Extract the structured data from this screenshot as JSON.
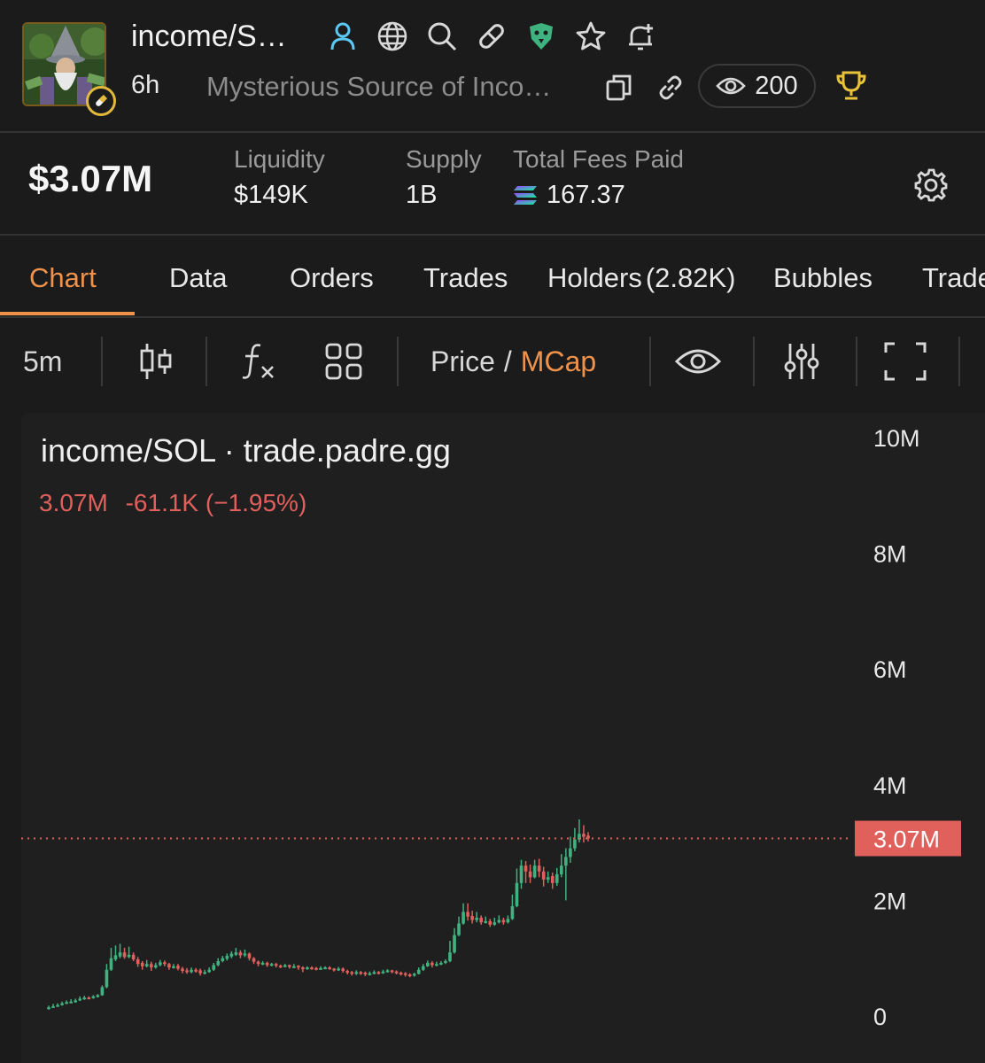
{
  "header": {
    "title": "income/S…",
    "age": "6h",
    "description": "Mysterious Source of Inco…",
    "viewers": "200",
    "icons": [
      "user-icon",
      "globe-icon",
      "search-icon",
      "pill-icon",
      "eagle-icon",
      "star-icon",
      "bell-plus-icon"
    ]
  },
  "stats": {
    "market_cap": "$3.07M",
    "liquidity_label": "Liquidity",
    "liquidity_value": "$149K",
    "supply_label": "Supply",
    "supply_value": "1B",
    "fees_label": "Total Fees Paid",
    "fees_value": "167.37"
  },
  "tabs": [
    {
      "label": "Chart",
      "active": true
    },
    {
      "label": "Data"
    },
    {
      "label": "Orders"
    },
    {
      "label": "Trades"
    },
    {
      "label": "Holders",
      "count": "(2.82K)"
    },
    {
      "label": "Bubbles"
    },
    {
      "label": "Trade"
    }
  ],
  "toolbar": {
    "interval": "5m",
    "price_label": "Price",
    "separator": "/",
    "mcap_label": "MCap"
  },
  "chart": {
    "title": "income/SOL · trade.padre.gg",
    "legend_value": "3.07M",
    "legend_change": "-61.1K (−1.95%)",
    "current_label": "3.07M",
    "colors": {
      "up": "#3fb27f",
      "down": "#e0605c",
      "accent": "#f0924a"
    }
  },
  "chart_data": {
    "type": "candlestick",
    "title": "income/SOL · trade.padre.gg",
    "y_tick_labels": [
      "10M",
      "8M",
      "6M",
      "4M",
      "2M",
      "0"
    ],
    "y_ticks": [
      10000000,
      8000000,
      6000000,
      4000000,
      2000000,
      0
    ],
    "ylim": [
      0,
      10000000
    ],
    "current_value": 3070000,
    "series": [
      {
        "candles": [
          [
            0.15,
            0.13,
            0.18,
            0.11
          ],
          [
            0.17,
            0.15,
            0.21,
            0.14
          ],
          [
            0.19,
            0.17,
            0.22,
            0.16
          ],
          [
            0.22,
            0.19,
            0.25,
            0.18
          ],
          [
            0.24,
            0.22,
            0.27,
            0.21
          ],
          [
            0.25,
            0.24,
            0.29,
            0.23
          ],
          [
            0.27,
            0.24,
            0.3,
            0.23
          ],
          [
            0.3,
            0.27,
            0.34,
            0.26
          ],
          [
            0.32,
            0.29,
            0.35,
            0.28
          ],
          [
            0.31,
            0.32,
            0.34,
            0.29
          ],
          [
            0.34,
            0.31,
            0.36,
            0.3
          ],
          [
            0.36,
            0.33,
            0.38,
            0.32
          ],
          [
            0.5,
            0.36,
            0.53,
            0.35
          ],
          [
            0.8,
            0.5,
            0.9,
            0.48
          ],
          [
            1.0,
            0.8,
            1.18,
            0.78
          ],
          [
            1.05,
            0.98,
            1.22,
            0.95
          ],
          [
            1.1,
            1.03,
            1.25,
            1.0
          ],
          [
            1.02,
            1.1,
            1.18,
            0.99
          ],
          [
            1.06,
            1.02,
            1.2,
            1.0
          ],
          [
            0.98,
            1.06,
            1.1,
            0.95
          ],
          [
            0.9,
            0.98,
            1.02,
            0.85
          ],
          [
            0.86,
            0.92,
            0.95,
            0.8
          ],
          [
            0.9,
            0.86,
            0.97,
            0.84
          ],
          [
            0.84,
            0.9,
            0.94,
            0.78
          ],
          [
            0.88,
            0.84,
            0.92,
            0.82
          ],
          [
            0.93,
            0.88,
            0.97,
            0.86
          ],
          [
            0.9,
            0.93,
            0.96,
            0.86
          ],
          [
            0.84,
            0.9,
            0.92,
            0.8
          ],
          [
            0.86,
            0.84,
            0.9,
            0.82
          ],
          [
            0.82,
            0.87,
            0.9,
            0.79
          ],
          [
            0.78,
            0.82,
            0.85,
            0.74
          ],
          [
            0.76,
            0.79,
            0.83,
            0.73
          ],
          [
            0.8,
            0.76,
            0.84,
            0.74
          ],
          [
            0.78,
            0.8,
            0.83,
            0.75
          ],
          [
            0.74,
            0.79,
            0.82,
            0.7
          ],
          [
            0.76,
            0.74,
            0.8,
            0.72
          ],
          [
            0.8,
            0.76,
            0.84,
            0.75
          ],
          [
            0.88,
            0.8,
            0.92,
            0.78
          ],
          [
            0.95,
            0.88,
            1.0,
            0.86
          ],
          [
            1.0,
            0.95,
            1.04,
            0.93
          ],
          [
            1.04,
            0.99,
            1.08,
            0.96
          ],
          [
            1.08,
            1.03,
            1.12,
            1.0
          ],
          [
            1.1,
            1.06,
            1.18,
            1.04
          ],
          [
            1.05,
            1.1,
            1.14,
            1.0
          ],
          [
            1.08,
            1.05,
            1.15,
            1.02
          ],
          [
            1.0,
            1.08,
            1.1,
            0.96
          ],
          [
            0.94,
            1.0,
            1.02,
            0.9
          ],
          [
            0.9,
            0.94,
            0.96,
            0.86
          ],
          [
            0.92,
            0.9,
            0.95,
            0.88
          ],
          [
            0.88,
            0.92,
            0.94,
            0.85
          ],
          [
            0.9,
            0.88,
            0.92,
            0.86
          ],
          [
            0.87,
            0.9,
            0.92,
            0.84
          ],
          [
            0.86,
            0.87,
            0.89,
            0.83
          ],
          [
            0.88,
            0.86,
            0.9,
            0.84
          ],
          [
            0.85,
            0.88,
            0.89,
            0.82
          ],
          [
            0.86,
            0.85,
            0.9,
            0.83
          ],
          [
            0.84,
            0.87,
            0.88,
            0.8
          ],
          [
            0.82,
            0.84,
            0.86,
            0.76
          ],
          [
            0.84,
            0.82,
            0.86,
            0.8
          ],
          [
            0.83,
            0.84,
            0.86,
            0.8
          ],
          [
            0.82,
            0.83,
            0.85,
            0.79
          ],
          [
            0.83,
            0.82,
            0.86,
            0.8
          ],
          [
            0.84,
            0.83,
            0.86,
            0.81
          ],
          [
            0.82,
            0.84,
            0.86,
            0.8
          ],
          [
            0.8,
            0.82,
            0.83,
            0.77
          ],
          [
            0.82,
            0.8,
            0.85,
            0.78
          ],
          [
            0.78,
            0.82,
            0.84,
            0.75
          ],
          [
            0.75,
            0.78,
            0.8,
            0.72
          ],
          [
            0.73,
            0.76,
            0.78,
            0.7
          ],
          [
            0.76,
            0.73,
            0.79,
            0.71
          ],
          [
            0.74,
            0.76,
            0.78,
            0.71
          ],
          [
            0.72,
            0.75,
            0.77,
            0.69
          ],
          [
            0.74,
            0.72,
            0.77,
            0.7
          ],
          [
            0.76,
            0.74,
            0.79,
            0.72
          ],
          [
            0.75,
            0.76,
            0.78,
            0.72
          ],
          [
            0.77,
            0.75,
            0.8,
            0.73
          ],
          [
            0.79,
            0.77,
            0.81,
            0.75
          ],
          [
            0.77,
            0.79,
            0.8,
            0.74
          ],
          [
            0.75,
            0.77,
            0.79,
            0.72
          ],
          [
            0.73,
            0.75,
            0.77,
            0.7
          ],
          [
            0.71,
            0.74,
            0.76,
            0.68
          ],
          [
            0.7,
            0.72,
            0.74,
            0.67
          ],
          [
            0.73,
            0.7,
            0.75,
            0.68
          ],
          [
            0.8,
            0.73,
            0.84,
            0.72
          ],
          [
            0.86,
            0.8,
            0.9,
            0.78
          ],
          [
            0.92,
            0.86,
            0.96,
            0.85
          ],
          [
            0.88,
            0.92,
            0.95,
            0.84
          ],
          [
            0.9,
            0.88,
            0.94,
            0.86
          ],
          [
            0.92,
            0.9,
            0.95,
            0.88
          ],
          [
            0.95,
            0.92,
            0.98,
            0.9
          ],
          [
            1.1,
            0.95,
            1.3,
            0.93
          ],
          [
            1.4,
            1.1,
            1.52,
            1.08
          ],
          [
            1.6,
            1.4,
            1.72,
            1.38
          ],
          [
            1.8,
            1.6,
            1.95,
            1.58
          ],
          [
            1.72,
            1.8,
            1.95,
            1.65
          ],
          [
            1.66,
            1.73,
            1.82,
            1.6
          ],
          [
            1.7,
            1.66,
            1.8,
            1.62
          ],
          [
            1.62,
            1.7,
            1.74,
            1.58
          ],
          [
            1.64,
            1.62,
            1.72,
            1.6
          ],
          [
            1.58,
            1.64,
            1.68,
            1.54
          ],
          [
            1.62,
            1.58,
            1.7,
            1.56
          ],
          [
            1.66,
            1.62,
            1.74,
            1.6
          ],
          [
            1.62,
            1.66,
            1.7,
            1.58
          ],
          [
            1.68,
            1.62,
            1.74,
            1.6
          ],
          [
            1.9,
            1.68,
            2.1,
            1.66
          ],
          [
            2.3,
            1.9,
            2.55,
            1.88
          ],
          [
            2.6,
            2.3,
            2.7,
            2.2
          ],
          [
            2.5,
            2.6,
            2.68,
            2.3
          ],
          [
            2.4,
            2.5,
            2.62,
            2.3
          ],
          [
            2.6,
            2.4,
            2.7,
            2.38
          ],
          [
            2.5,
            2.6,
            2.72,
            2.4
          ],
          [
            2.36,
            2.5,
            2.58,
            2.24
          ],
          [
            2.4,
            2.36,
            2.5,
            2.3
          ],
          [
            2.3,
            2.42,
            2.48,
            2.2
          ],
          [
            2.45,
            2.3,
            2.56,
            2.25
          ],
          [
            2.6,
            2.45,
            2.8,
            2.4
          ],
          [
            2.75,
            2.6,
            2.9,
            2.0
          ],
          [
            2.9,
            2.75,
            3.1,
            2.65
          ],
          [
            3.05,
            2.9,
            3.25,
            2.85
          ],
          [
            3.15,
            3.05,
            3.4,
            3.0
          ],
          [
            3.1,
            3.15,
            3.3,
            3.0
          ],
          [
            3.07,
            3.12,
            3.18,
            3.02
          ]
        ]
      }
    ],
    "candle_order": [
      "close",
      "open",
      "high",
      "low"
    ],
    "candle_units": "millions"
  }
}
